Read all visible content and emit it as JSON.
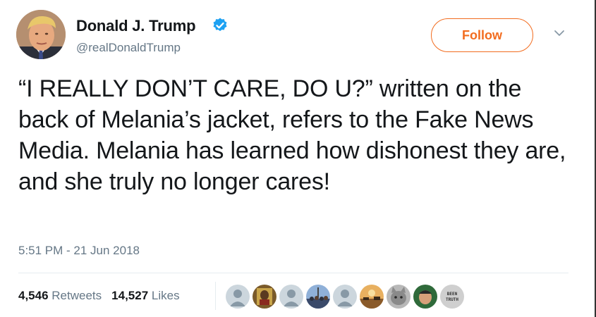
{
  "tweet": {
    "author": {
      "display_name": "Donald J. Trump",
      "handle": "@realDonaldTrump",
      "verified": true,
      "avatar_icon": "user-avatar"
    },
    "follow_label": "Follow",
    "menu_icon": "chevron-down-icon",
    "text": "“I REALLY DON’T CARE, DO U?” written on the back of Melania’s jacket, refers to the Fake News Media. Melania has learned how dishonest they are, and she truly no longer cares!",
    "timestamp": "5:51 PM - 21 Jun 2018",
    "stats": {
      "retweets_count": "4,546",
      "retweets_label": "Retweets",
      "likes_count": "14,527",
      "likes_label": "Likes"
    },
    "likers": [
      {
        "icon": "default-avatar-icon"
      },
      {
        "icon": "portrait-avatar-icon"
      },
      {
        "icon": "default-avatar-icon"
      },
      {
        "icon": "crowd-avatar-icon"
      },
      {
        "icon": "default-avatar-icon"
      },
      {
        "icon": "landscape-avatar-icon"
      },
      {
        "icon": "cat-avatar-icon"
      },
      {
        "icon": "face-avatar-icon"
      },
      {
        "icon": "text-avatar-icon",
        "text": "BEEN TRUTH"
      }
    ],
    "colors": {
      "follow_accent": "#f26c1f",
      "verified_blue": "#1da1f2",
      "secondary_text": "#657786",
      "primary_text": "#14171a"
    }
  }
}
